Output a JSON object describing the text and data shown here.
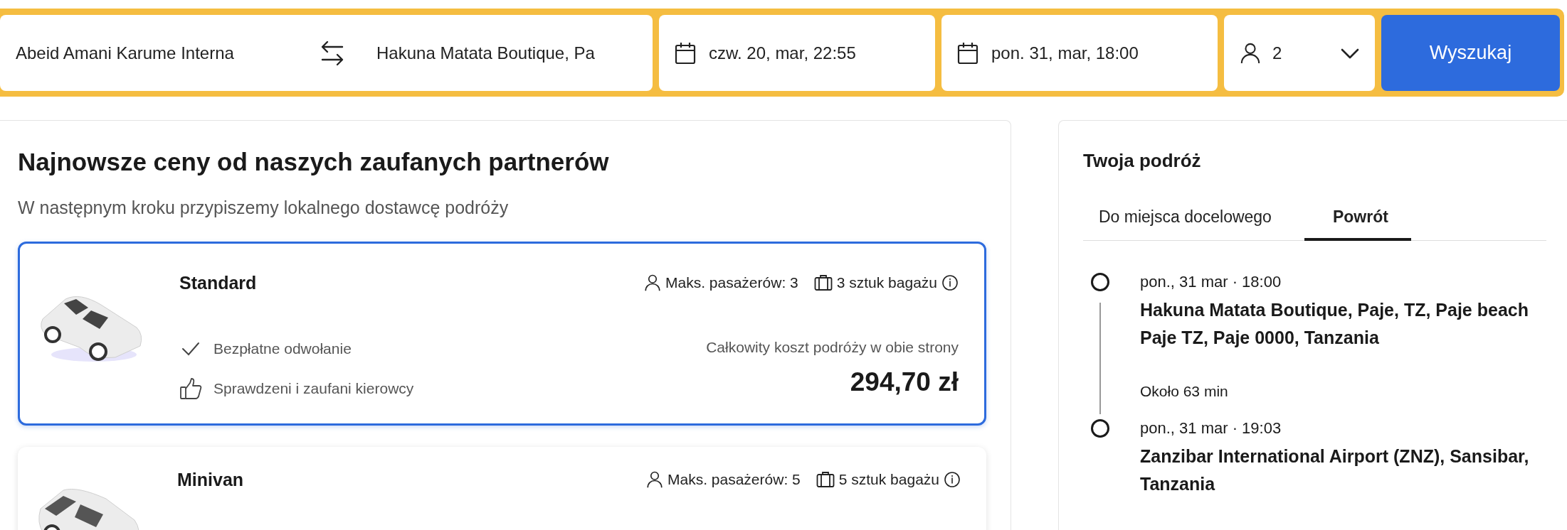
{
  "search_bar": {
    "origin": "Abeid Amani Karume Interna",
    "destination": "Hakuna Matata Boutique, Pa",
    "outbound_date": "czw. 20, mar, 22:55",
    "return_date": "pon. 31, mar, 18:00",
    "passengers": "2",
    "search_button": "Wyszukaj"
  },
  "results": {
    "title": "Najnowsze ceny od naszych zaufanych partnerów",
    "subtitle": "W następnym kroku przypiszemy lokalnego dostawcę podróży",
    "offers": [
      {
        "kind": "sedan",
        "name": "Standard",
        "selected": true,
        "passengers": "Maks. pasażerów: 3",
        "luggage": "3 sztuk bagażu",
        "features": [
          {
            "kind": "check",
            "text": "Bezpłatne odwołanie"
          },
          {
            "kind": "thumbs-up",
            "text": "Sprawdzeni i zaufani kierowcy"
          }
        ],
        "price_label": "Całkowity koszt podróży w obie strony",
        "price": "294,70 zł"
      },
      {
        "kind": "minivan",
        "name": "Minivan",
        "selected": false,
        "passengers": "Maks. pasażerów: 5",
        "luggage": "5 sztuk bagażu"
      }
    ]
  },
  "trip": {
    "title": "Twoja podróż",
    "tabs": [
      {
        "label": "Do miejsca docelowego",
        "selected": false
      },
      {
        "label": "Powrót",
        "selected": true
      }
    ],
    "stops": [
      {
        "time": "pon., 31 mar · 18:00",
        "place": "Hakuna Matata Boutique, Paje, TZ, Paje beach Paje TZ, Paje 0000, Tanzania",
        "duration": "Około 63 min"
      },
      {
        "time": "pon., 31 mar · 19:03",
        "place": "Zanzibar International Airport (ZNZ), Sansibar, Tanzania"
      }
    ]
  }
}
